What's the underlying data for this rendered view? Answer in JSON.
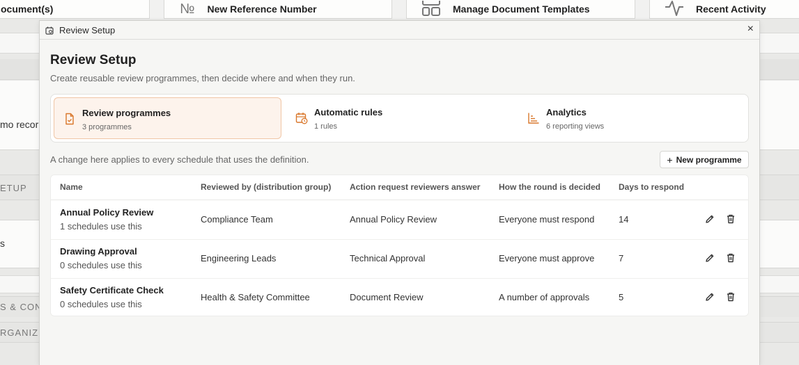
{
  "background": {
    "topbar_cards": [
      {
        "label": "ocument(s)",
        "icon": "document-icon"
      },
      {
        "label": "New Reference Number",
        "icon": "numero-icon",
        "glyph": "№"
      },
      {
        "label": "Manage Document Templates",
        "icon": "templates-icon"
      },
      {
        "label": "Recent Activity",
        "icon": "activity-icon"
      }
    ],
    "left_text_1": "mo recor",
    "left_text_2": "s",
    "section_labels": [
      "ETUP",
      "S & CON",
      "RGANIZ"
    ]
  },
  "modal": {
    "window_title": "Review Setup",
    "close_glyph": "×",
    "heading": "Review Setup",
    "subtitle": "Create reusable review programmes, then decide where and when they run.",
    "tabs": [
      {
        "title": "Review programmes",
        "count": "3 programmes",
        "icon": "file-check-icon",
        "active": true
      },
      {
        "title": "Automatic rules",
        "count": "1 rules",
        "icon": "calendar-clock-icon",
        "active": false
      },
      {
        "title": "Analytics",
        "count": "6 reporting views",
        "icon": "bar-chart-icon",
        "active": false
      }
    ],
    "note": "A change here applies to every schedule that uses the definition.",
    "new_button": {
      "plus": "+",
      "label": "New programme"
    },
    "table": {
      "headers": [
        "Name",
        "Reviewed by (distribution group)",
        "Action request reviewers answer",
        "How the round is decided",
        "Days to respond"
      ],
      "rows": [
        {
          "name": "Annual Policy Review",
          "uses": "1 schedules use this",
          "group": "Compliance Team",
          "action": "Annual Policy Review",
          "decided": "Everyone must respond",
          "days": "14"
        },
        {
          "name": "Drawing Approval",
          "uses": "0 schedules use this",
          "group": "Engineering Leads",
          "action": "Technical Approval",
          "decided": "Everyone must approve",
          "days": "7"
        },
        {
          "name": "Safety Certificate Check",
          "uses": "0 schedules use this",
          "group": "Health & Safety Committee",
          "action": "Document Review",
          "decided": "A number of approvals",
          "days": "5"
        }
      ]
    },
    "accent_color": "#d9772b"
  }
}
